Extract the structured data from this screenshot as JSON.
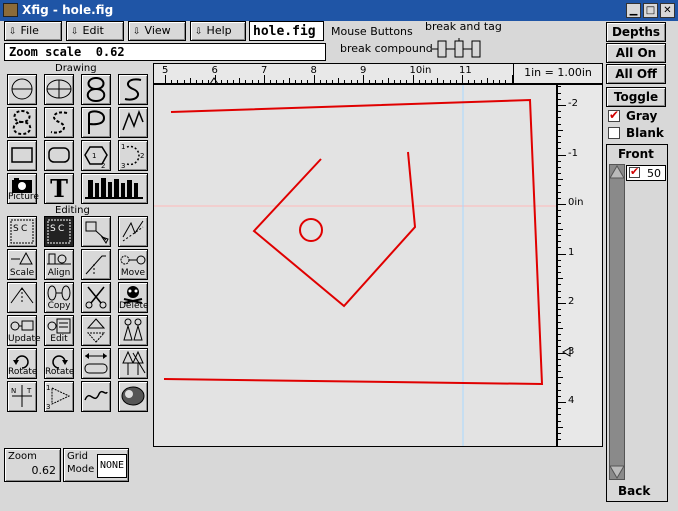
{
  "window": {
    "title": "Xfig - hole.fig"
  },
  "menu": {
    "file": "File",
    "edit": "Edit",
    "view": "View",
    "help": "Help",
    "filename": "hole.fig"
  },
  "mouse_panel": {
    "title": "Mouse Buttons",
    "left": "break compound",
    "right": "break and tag"
  },
  "zoom_bar": {
    "label": "Zoom scale",
    "value": "0.62"
  },
  "drawing_label": "Drawing",
  "editing_label": "Editing",
  "tools": {
    "picture": "Picture",
    "text": "T",
    "scale": "Scale",
    "align": "Align",
    "move": "Move",
    "copy": "Copy",
    "delete": "Delete",
    "update": "Update",
    "edit": "Edit",
    "rotate_cw": "Rotate",
    "rotate_ccw": "Rotate"
  },
  "ruler": {
    "top_ticks": [
      "5",
      "6",
      "7",
      "8",
      "9",
      "10in",
      "11"
    ],
    "unit": "1in = 1.00in",
    "side_ticks": [
      "-2",
      "-1",
      "0in",
      "1",
      "2",
      "3",
      "4"
    ]
  },
  "depth_panel": {
    "depths": "Depths",
    "all_on": "All On",
    "all_off": "All Off",
    "toggle": "Toggle",
    "gray": "Gray",
    "gray_checked": true,
    "blank": "Blank",
    "blank_checked": false,
    "front": "Front",
    "depth_value": "50",
    "back": "Back"
  },
  "bottom": {
    "zoom_label": "Zoom",
    "zoom_value": "0.62",
    "grid_label": "Grid",
    "mode_label": "Mode",
    "grid_value": "NONE"
  },
  "colors": {
    "title_bar": "#1f55a6",
    "figure": "#e00000",
    "canvas": "#e3e3e3"
  }
}
